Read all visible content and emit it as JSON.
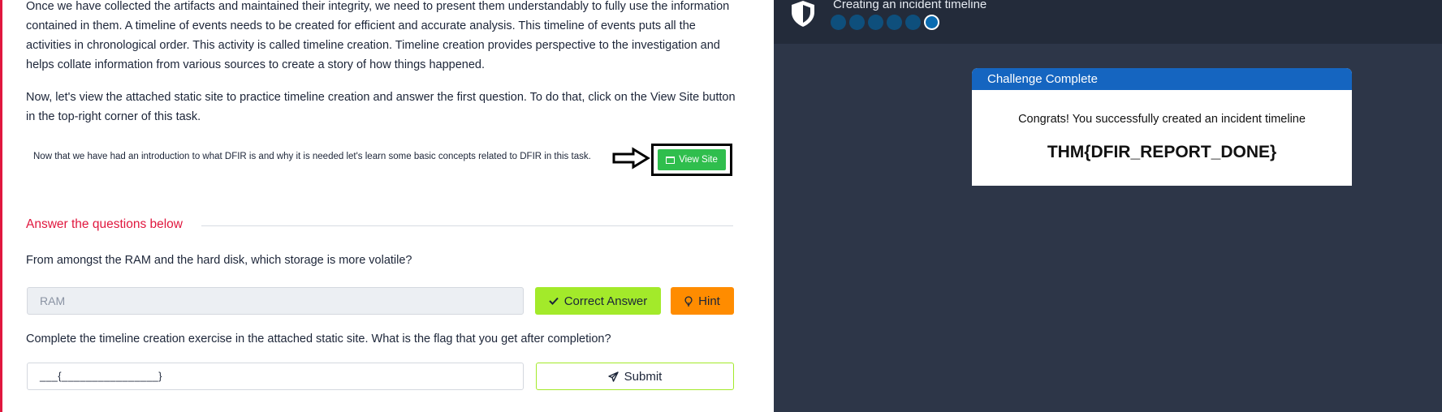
{
  "task": {
    "paragraph_1": "Once we have collected the artifacts and maintained their integrity, we need to present them understandably to fully use the information contained in them. A timeline of events needs to be created for efficient and accurate analysis. This timeline of events puts all the activities in chronological order. This activity is called timeline creation. Timeline creation provides perspective to the investigation and helps collate information from various sources to create a story of how things happened.",
    "paragraph_2": "Now, let's view the attached static site to practice timeline creation and answer the first question. To do that, click on the View Site button in the top-right corner of this task.",
    "embedded_note": "Now that we have had an introduction to what DFIR is and why it is needed let's learn some basic concepts related to DFIR in this task.",
    "view_site_label": "View Site"
  },
  "questions": {
    "heading": "Answer the questions below",
    "q1": {
      "text": "From amongst the RAM and the hard disk, which storage is more volatile?",
      "answer_value": "RAM",
      "correct_label": "Correct Answer",
      "hint_label": "Hint"
    },
    "q2": {
      "text": "Complete the timeline creation exercise in the attached static site. What is the flag that you get after completion?",
      "placeholder": "___{________________}",
      "submit_label": "Submit"
    }
  },
  "site": {
    "title": "Creating an incident timeline",
    "progress_steps": 6,
    "progress_active": 6,
    "card_title": "Challenge Complete",
    "card_message": "Congrats! You successfully created an incident timeline",
    "flag": "THM{DFIR_REPORT_DONE}"
  },
  "colors": {
    "accent_red": "#e0173e",
    "view_site_green": "#2fbe4d",
    "correct_green": "#a3ea2a",
    "hint_orange": "#ff8c00",
    "panel_dark": "#2d3648",
    "card_blue": "#1565c0"
  },
  "icons": {
    "view_site": "window-icon",
    "correct": "check-icon",
    "hint": "lightbulb-icon",
    "submit": "paper-plane-icon",
    "site_logo": "shield-icon",
    "pointer": "arrow-right-icon"
  }
}
